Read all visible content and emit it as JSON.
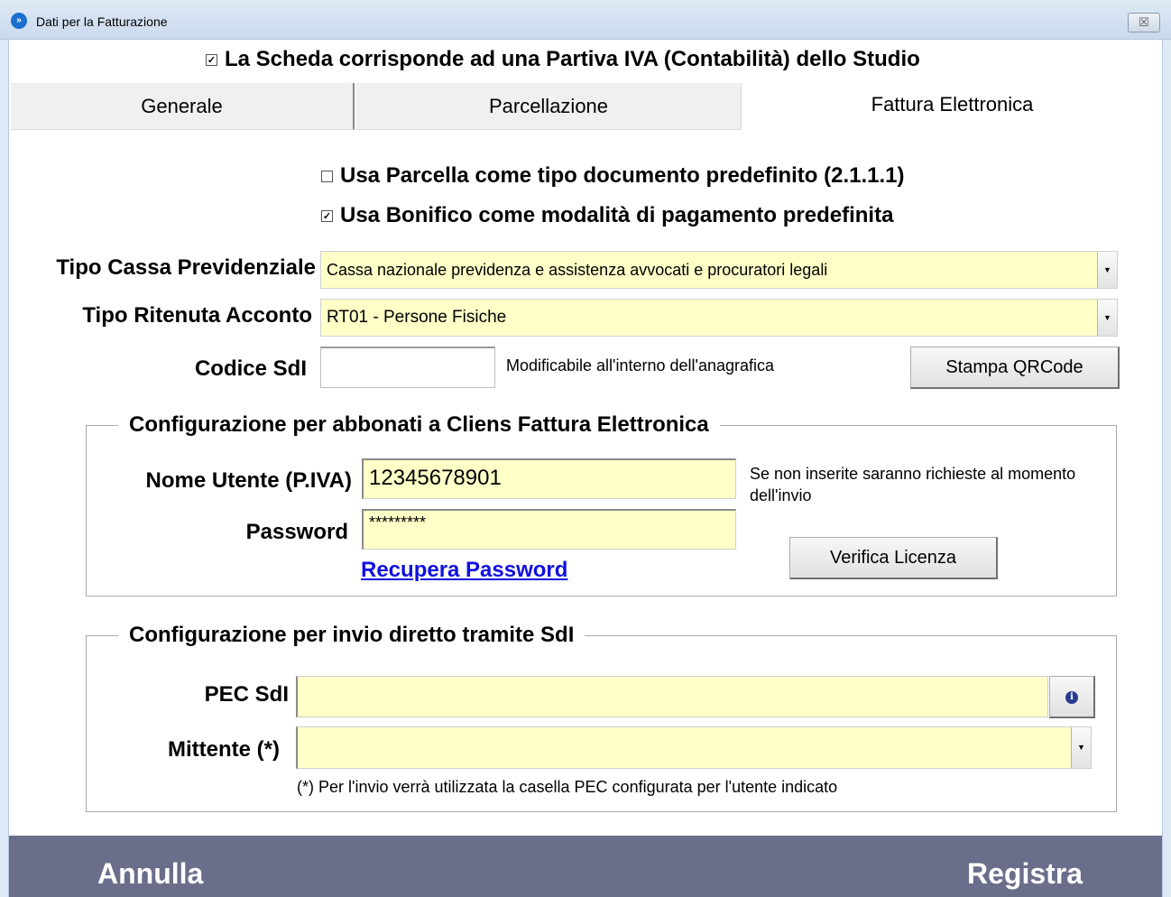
{
  "window": {
    "title": "Dati per la Fatturazione",
    "close_glyph": "☒"
  },
  "top_checkbox": {
    "checked": true,
    "label": "La Scheda corrisponde ad una Partiva IVA (Contabilità) dello Studio"
  },
  "tabs": [
    {
      "label": "Generale",
      "active": false
    },
    {
      "label": "Parcellazione",
      "active": false
    },
    {
      "label": "Fattura Elettronica",
      "active": true
    }
  ],
  "options": {
    "usa_parcella": {
      "checked": false,
      "label": "Usa Parcella come tipo documento predefinito (2.1.1.1)"
    },
    "usa_bonifico": {
      "checked": true,
      "label": "Usa Bonifico come modalità di  pagamento predefinita"
    }
  },
  "cassa": {
    "label": "Tipo Cassa Previdenziale",
    "value": "Cassa nazionale previdenza e assistenza avvocati e procuratori legali"
  },
  "ritenuta": {
    "label": "Tipo Ritenuta Acconto",
    "value": "RT01 - Persone Fisiche"
  },
  "codice_sdi": {
    "label": "Codice SdI",
    "value": "",
    "note": "Modificabile all'interno dell'anagrafica",
    "button": "Stampa QRCode"
  },
  "cliens_group": {
    "legend": "Configurazione per abbonati a Cliens Fattura Elettronica",
    "username_label": "Nome Utente (P.IVA)",
    "username_value": "12345678901",
    "password_label": "Password",
    "password_value": "*********",
    "note": "Se non inserite saranno richieste al momento dell'invio",
    "recover_link": "Recupera Password",
    "verify_button": "Verifica Licenza"
  },
  "sdi_group": {
    "legend": "Configurazione per invio diretto tramite SdI",
    "pec_label": "PEC SdI",
    "pec_value": "",
    "info_icon": "info-icon",
    "mittente_label": "Mittente (*)",
    "mittente_value": "",
    "footnote": "(*) Per l'invio verrà utilizzata la casella PEC configurata per l'utente indicato"
  },
  "footer": {
    "cancel": "Annulla",
    "save": "Registra",
    "color": "#6b6e8a"
  },
  "colors": {
    "field_bg": "#ffffc8",
    "link": "#1010e0"
  }
}
